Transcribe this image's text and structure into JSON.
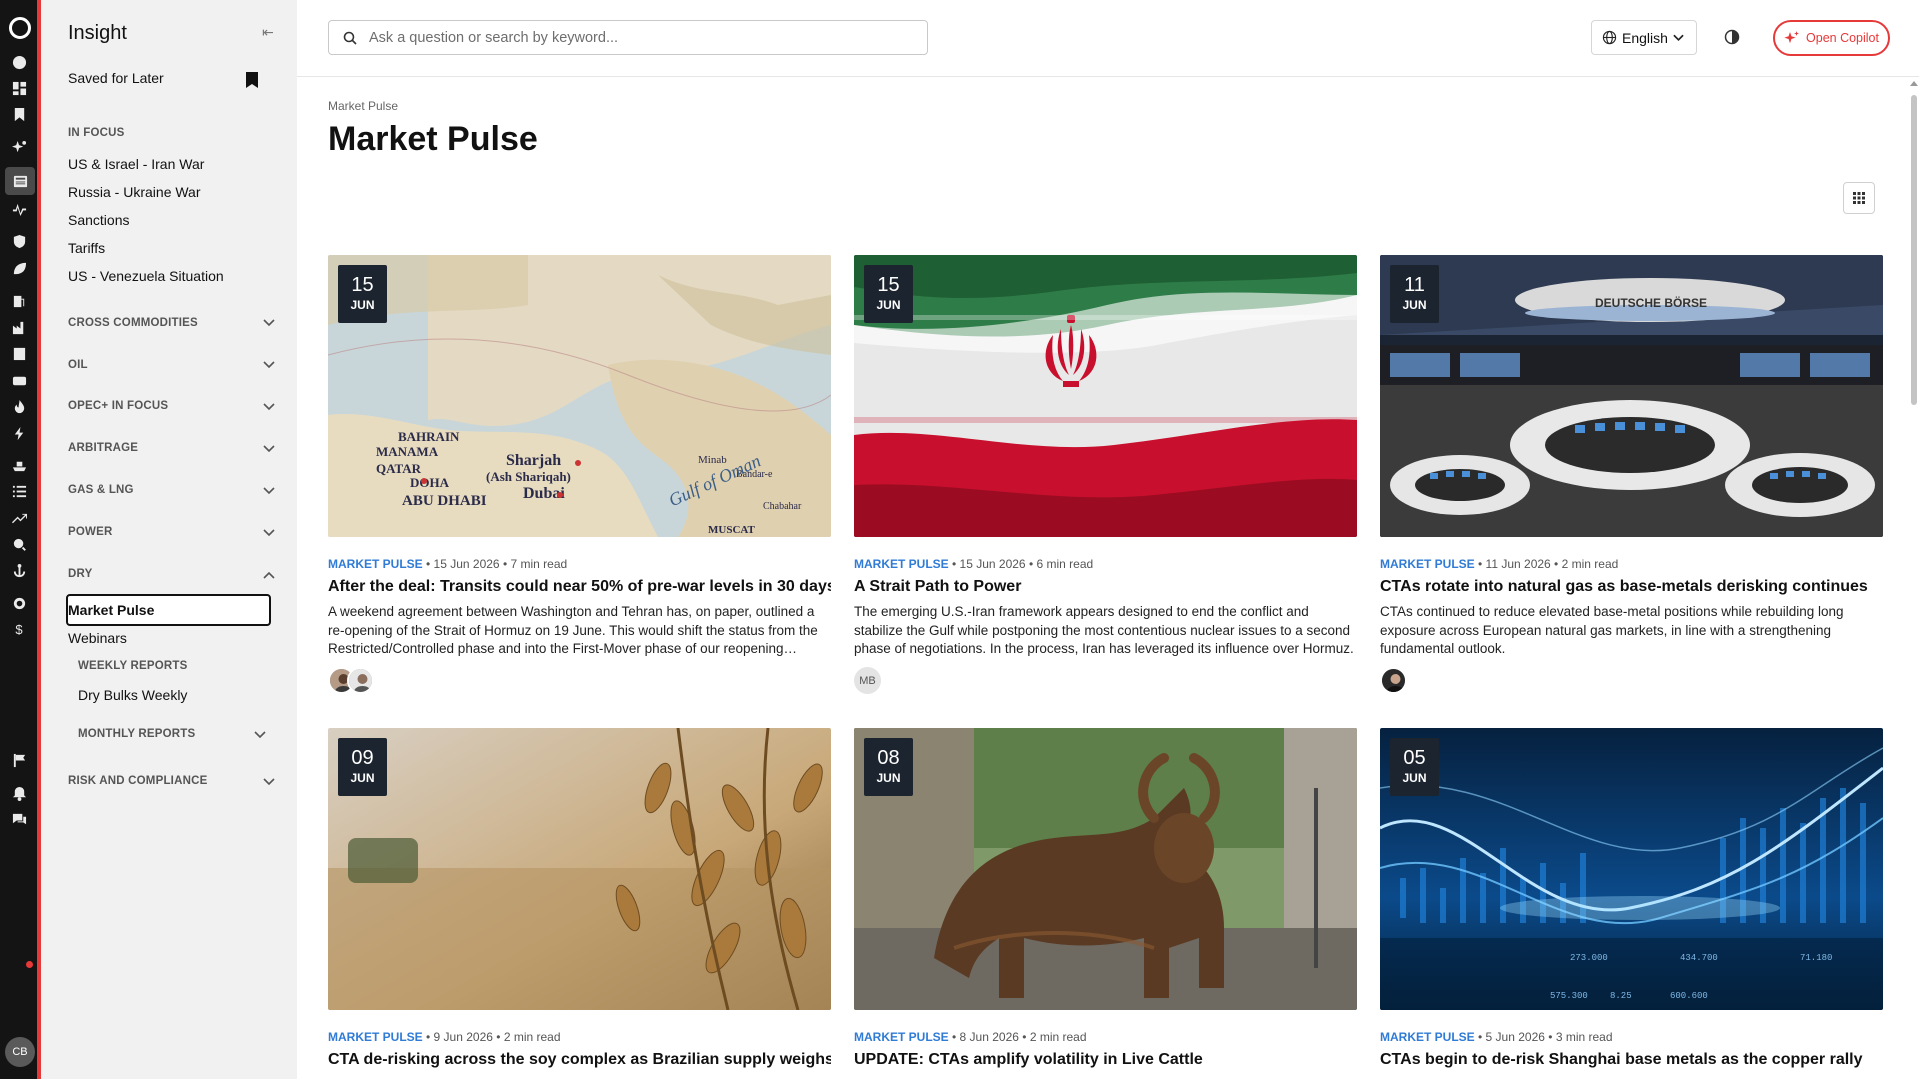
{
  "app": {
    "title": "Insight",
    "user_initials": "CB"
  },
  "rail": {
    "icons": [
      "logo-icon",
      "globe-icon",
      "dashboard-icon",
      "bookmark-icon",
      "sparkle-icon",
      "news-icon",
      "chart-icon",
      "shield-icon",
      "leaf-icon",
      "fuel-icon",
      "factory-icon",
      "building-icon",
      "lng-icon",
      "flame-icon",
      "lightning-icon",
      "ship-icon",
      "list-icon",
      "trend-icon",
      "analysis-icon",
      "anchor-icon",
      "globe-gear-icon",
      "dollar-icon",
      "flag-icon",
      "bell-icon",
      "chat-icon"
    ]
  },
  "sidebar": {
    "saved_label": "Saved for Later",
    "in_focus_header": "IN FOCUS",
    "in_focus_items": [
      "US & Israel - Iran War",
      "Russia - Ukraine War",
      "Sanctions",
      "Tariffs",
      "US - Venezuela Situation"
    ],
    "sections": [
      "CROSS COMMODITIES",
      "OIL",
      "OPEC+ IN FOCUS",
      "ARBITRAGE",
      "GAS & LNG",
      "POWER",
      "DRY"
    ],
    "dry_items": [
      "Market Pulse",
      "Webinars"
    ],
    "weekly_header": "WEEKLY REPORTS",
    "weekly_items": [
      "Dry Bulks Weekly"
    ],
    "monthly_header": "MONTHLY REPORTS",
    "risk_header": "RISK AND COMPLIANCE"
  },
  "topbar": {
    "search_placeholder": "Ask a question or search by keyword...",
    "language": "English",
    "copilot_label": "Open Copilot"
  },
  "page": {
    "breadcrumb": "Market Pulse",
    "title": "Market Pulse"
  },
  "articles": [
    {
      "day": "15",
      "month": "JUN",
      "category": "MARKET PULSE",
      "date": "15 Jun 2026",
      "read": "7 min read",
      "title": "After the deal: Transits could near 50% of pre-war levels in 30 days",
      "excerpt": "A weekend agreement between Washington and Tehran has, on paper, outlined a re-opening of the Strait of Hormuz on 19 June. This would shift the status from the Restricted/Controlled phase and into the First-Mover phase of our reopening framework.",
      "authors": [
        "photo",
        "photo"
      ],
      "image": "map-icon",
      "map_labels": [
        "BAHRAIN",
        "MANAMA",
        "QATAR",
        "DOHA",
        "Sharjah",
        "(Ash Shariqah)",
        "Dubai",
        "ABU DHABI",
        "Gulf of Oman",
        "MUSCAT",
        "Minab",
        "Bandar-e",
        "Chabahar"
      ]
    },
    {
      "day": "15",
      "month": "JUN",
      "category": "MARKET PULSE",
      "date": "15 Jun 2026",
      "read": "6 min read",
      "title": "A Strait Path to Power",
      "excerpt": "The emerging U.S.-Iran framework appears designed to end the conflict and stabilize the Gulf while postponing the most contentious nuclear issues to a second phase of negotiations. In the process, Iran has leveraged its influence over Hormuz.",
      "authors": [
        "MB"
      ],
      "image": "flag-image"
    },
    {
      "day": "11",
      "month": "JUN",
      "category": "MARKET PULSE",
      "date": "11 Jun 2026",
      "read": "2 min read",
      "title": "CTAs rotate into natural gas as base-metals derisking continues",
      "excerpt": "CTAs continued to reduce elevated base-metal positions while rebuilding long exposure across European natural gas markets, in line with a strengthening fundamental outlook.",
      "authors": [
        "photo"
      ],
      "image": "exchange-image",
      "sign": "DEUTSCHE BÖRSE"
    },
    {
      "day": "09",
      "month": "JUN",
      "category": "MARKET PULSE",
      "date": "9 Jun 2026",
      "read": "2 min read",
      "title": "CTA de-risking across the soy complex as Brazilian supply weighs",
      "excerpt": "",
      "authors": [],
      "image": "soy-image"
    },
    {
      "day": "08",
      "month": "JUN",
      "category": "MARKET PULSE",
      "date": "8 Jun 2026",
      "read": "2 min read",
      "title": "UPDATE: CTAs amplify volatility in Live Cattle",
      "excerpt": "",
      "authors": [],
      "image": "bull-image"
    },
    {
      "day": "05",
      "month": "JUN",
      "category": "MARKET PULSE",
      "date": "5 Jun 2026",
      "read": "3 min read",
      "title": "CTAs begin to de-risk Shanghai base metals as the copper rally",
      "excerpt": "",
      "authors": [],
      "image": "ticker-image",
      "ticker_values": [
        "273.000",
        "434.700",
        "575.300",
        "600.600",
        "8.25",
        "71.180"
      ]
    }
  ]
}
